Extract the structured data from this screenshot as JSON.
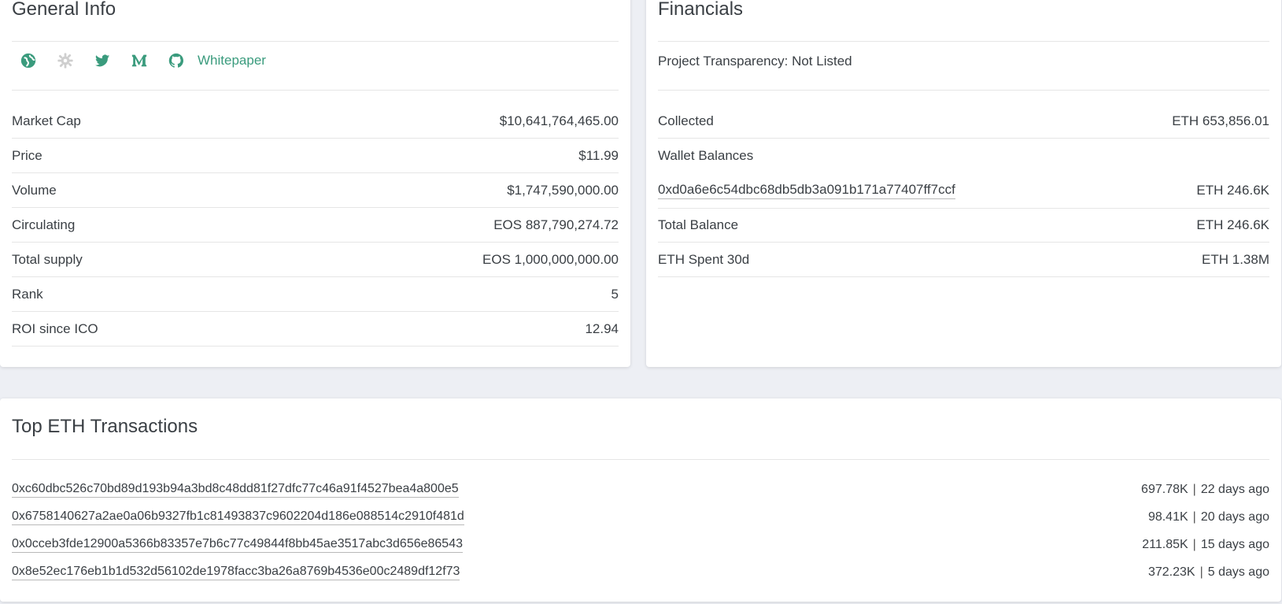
{
  "general": {
    "title": "General Info",
    "links": {
      "whitepaper_label": "Whitepaper"
    },
    "icons": [
      "globe-icon",
      "gear-icon",
      "twitter-icon",
      "medium-icon",
      "github-icon"
    ],
    "rows": [
      {
        "label": "Market Cap",
        "value": "$10,641,764,465.00"
      },
      {
        "label": "Price",
        "value": "$11.99"
      },
      {
        "label": "Volume",
        "value": "$1,747,590,000.00"
      },
      {
        "label": "Circulating",
        "value": "EOS 887,790,274.72"
      },
      {
        "label": "Total supply",
        "value": "EOS 1,000,000,000.00"
      },
      {
        "label": "Rank",
        "value": "5"
      },
      {
        "label": "ROI since ICO",
        "value": "12.94"
      }
    ]
  },
  "financials": {
    "title": "Financials",
    "transparency": "Project Transparency: Not Listed",
    "collected": {
      "label": "Collected",
      "value": "ETH 653,856.01"
    },
    "wallet_balances_label": "Wallet Balances",
    "wallet": {
      "address": "0xd0a6e6c54dbc68db5db3a091b171a77407ff7ccf",
      "value": "ETH 246.6K"
    },
    "total_balance": {
      "label": "Total Balance",
      "value": "ETH 246.6K"
    },
    "eth_spent": {
      "label": "ETH Spent 30d",
      "value": "ETH 1.38M"
    }
  },
  "transactions": {
    "title": "Top ETH Transactions",
    "separator": "|",
    "items": [
      {
        "hash": "0xc60dbc526c70bd89d193b94a3bd8c48dd81f27dfc77c46a91f4527bea4a800e5",
        "amount": "697.78K",
        "age": "22 days ago"
      },
      {
        "hash": "0x6758140627a2ae0a06b9327fb1c81493837c9602204d186e088514c2910f481d",
        "amount": "98.41K",
        "age": "20 days ago"
      },
      {
        "hash": "0x0cceb3fde12900a5366b83357e7b6c77c49844f8bb45ae3517abc3d656e86543",
        "amount": "211.85K",
        "age": "15 days ago"
      },
      {
        "hash": "0x8e52ec176eb1b1d532d56102de1978facc3ba26a8769b4536e00c2489df12f73",
        "amount": "372.23K",
        "age": "5 days ago"
      }
    ]
  },
  "colors": {
    "accent": "#3a9b7d",
    "icon_disabled": "#cfcfcf",
    "background": "#edeff4",
    "card": "#ffffff"
  }
}
